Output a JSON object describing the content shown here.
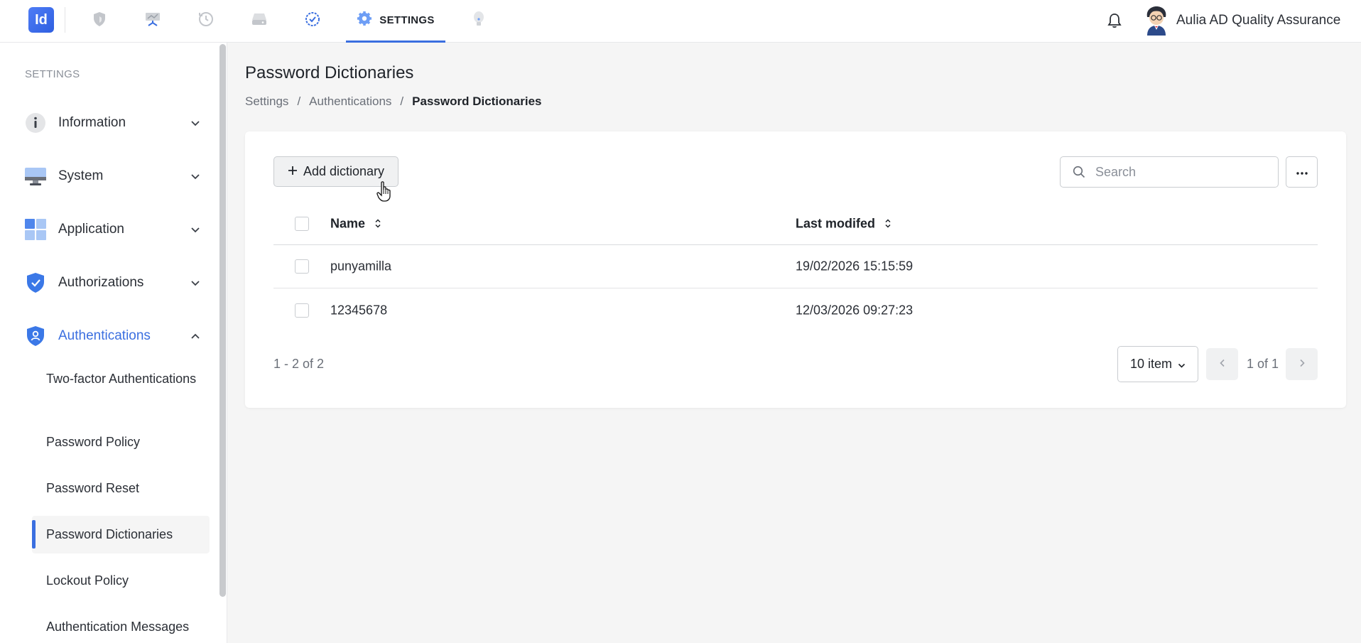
{
  "app": {
    "logo_text": "Id"
  },
  "topnav": {
    "icons": [
      "shield-icon",
      "presentation-icon",
      "history-icon",
      "drive-icon",
      "check-badge-icon"
    ],
    "active_tab": {
      "label": "SETTINGS",
      "icon": "gear-icon"
    },
    "extra_icon": "bulb-icon"
  },
  "user": {
    "name": "Aulia AD Quality Assurance"
  },
  "sidebar": {
    "heading": "SETTINGS",
    "items": [
      {
        "label": "Information",
        "icon": "info-icon",
        "expanded": false
      },
      {
        "label": "System",
        "icon": "monitor-icon",
        "expanded": false
      },
      {
        "label": "Application",
        "icon": "grid-icon",
        "expanded": false
      },
      {
        "label": "Authorizations",
        "icon": "shield-check-icon",
        "expanded": false
      },
      {
        "label": "Authentications",
        "icon": "shield-user-icon",
        "expanded": true
      }
    ],
    "subitems": [
      {
        "label": "Two-factor Authentications"
      },
      {
        "label": "Password Policy"
      },
      {
        "label": "Password Reset"
      },
      {
        "label": "Password Dictionaries",
        "active": true
      },
      {
        "label": "Lockout Policy"
      },
      {
        "label": "Authentication Messages"
      }
    ]
  },
  "page": {
    "title": "Password Dictionaries",
    "breadcrumb": [
      "Settings",
      "Authentications",
      "Password Dictionaries"
    ],
    "breadcrumb_sep": "/"
  },
  "toolbar": {
    "add_label": "Add dictionary",
    "search_placeholder": "Search",
    "more_label": "···"
  },
  "table": {
    "columns": [
      "Name",
      "Last modifed"
    ],
    "rows": [
      {
        "name": "punyamilla",
        "modified": "19/02/2026 15:15:59"
      },
      {
        "name": "12345678",
        "modified": "12/03/2026 09:27:23"
      }
    ]
  },
  "pagination": {
    "range": "1 - 2 of 2",
    "page_size": "10 item",
    "page_text": "1 of 1"
  },
  "colors": {
    "accent": "#3b6fe0",
    "background": "#f5f5f5"
  }
}
